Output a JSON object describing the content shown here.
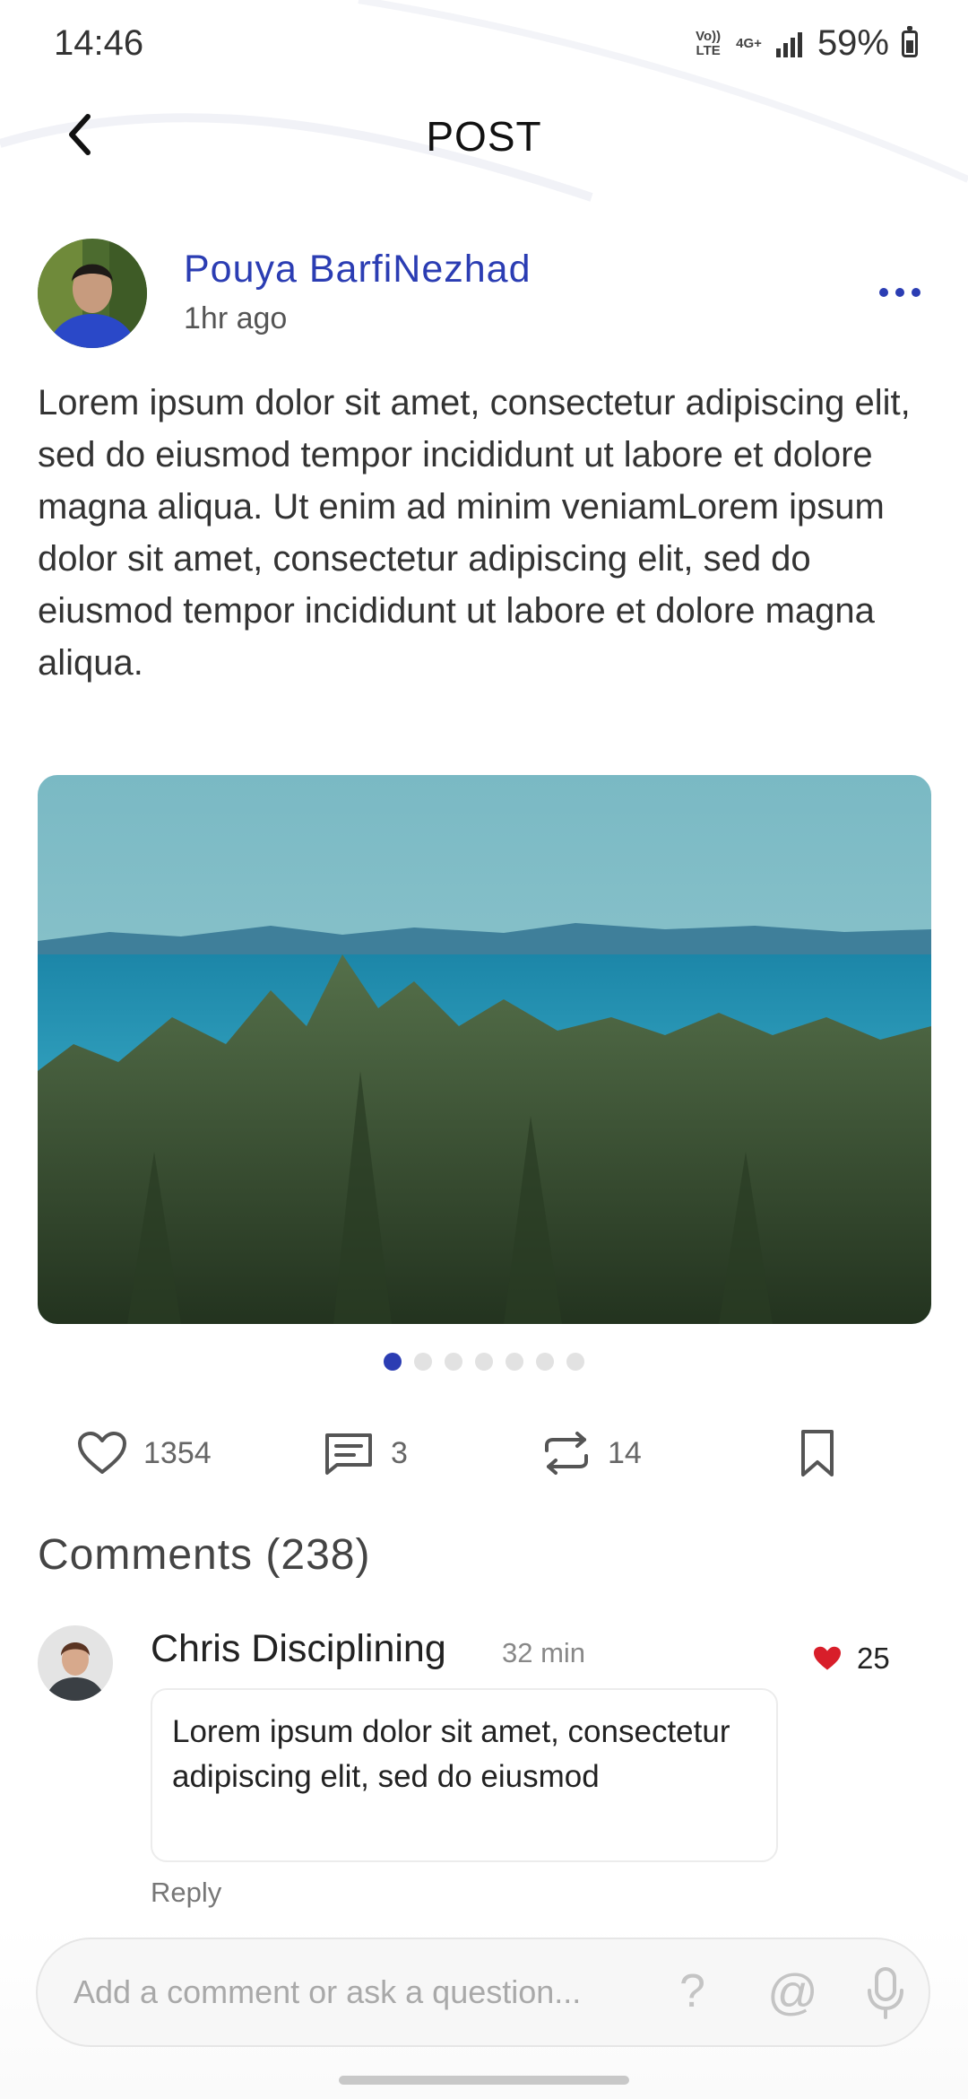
{
  "status_bar": {
    "time": "14:46",
    "network_top": "Vo)) LTE",
    "network_gen": "4G+",
    "battery": "59%"
  },
  "header": {
    "title": "POST"
  },
  "post": {
    "author": "Pouya BarfiNezhad",
    "time": "1hr ago",
    "text": "Lorem ipsum dolor sit amet, consectetur adipiscing elit, sed do eiusmod tempor incididunt ut labore et dolore magna aliqua. Ut enim ad minim veniamLorem ipsum dolor sit amet, consectetur adipiscing elit, sed do eiusmod tempor incididunt ut labore et dolore magna aliqua.",
    "image_icon": "landscape-photo",
    "carousel": {
      "total": 7,
      "active": 1
    },
    "likes": "1354",
    "comments": "3",
    "reposts": "14"
  },
  "comments_section": {
    "heading": "Comments (238)",
    "items": [
      {
        "name": "Chris Disciplining",
        "time": "32 min",
        "likes": "25",
        "text": "Lorem ipsum dolor sit amet, consectetur adipiscing elit, sed do eiusmod",
        "reply_label": "Reply"
      }
    ]
  },
  "input": {
    "placeholder": "Add a comment or ask a question...",
    "help_glyph": "?",
    "mention_glyph": "@"
  },
  "colors": {
    "accent": "#2b3db3",
    "heart": "#d81e2a"
  }
}
